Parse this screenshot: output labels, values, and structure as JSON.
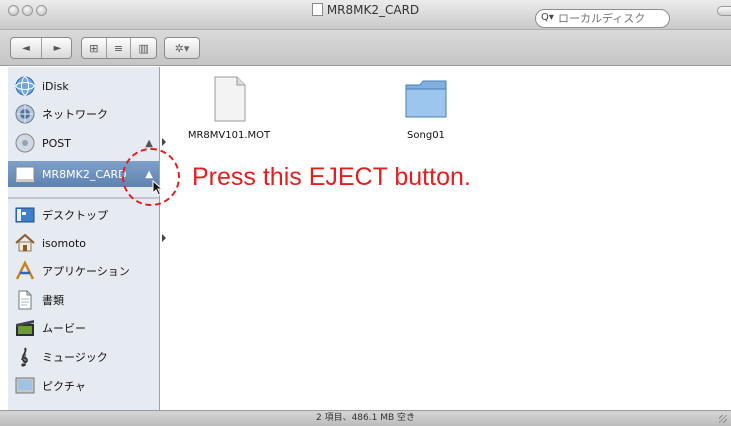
{
  "window": {
    "title": "MR8MK2_CARD"
  },
  "toolbar": {
    "back_icon": "◄",
    "forward_icon": "►",
    "view_icons": [
      "⊞",
      "≡",
      "▥"
    ],
    "action_label": "✲▾",
    "search_placeholder": "ローカルディスク",
    "search_icon": "Q▾"
  },
  "sidebar": {
    "items": [
      {
        "label": "iDisk",
        "icon": "idisk-icon"
      },
      {
        "label": "ネットワーク",
        "icon": "network-icon"
      },
      {
        "label": "POST",
        "icon": "disk-icon",
        "eject": "▲"
      },
      {
        "label": "MR8MK2_CARD",
        "icon": "card-drive-icon",
        "eject": "▲",
        "selected": true
      },
      {
        "label": "デスクトップ",
        "icon": "desktop-icon"
      },
      {
        "label": "isomoto",
        "icon": "home-icon"
      },
      {
        "label": "アプリケーション",
        "icon": "applications-icon"
      },
      {
        "label": "書類",
        "icon": "documents-icon"
      },
      {
        "label": "ムービー",
        "icon": "movies-icon"
      },
      {
        "label": "ミュージック",
        "icon": "music-icon"
      },
      {
        "label": "ピクチャ",
        "icon": "pictures-icon"
      }
    ]
  },
  "files": [
    {
      "name": "MR8MV101.MOT",
      "icon": "document-icon"
    },
    {
      "name": "Song01",
      "icon": "folder-icon"
    }
  ],
  "status": {
    "text": "2 項目、486.1 MB 空き"
  },
  "annotation": {
    "text": "Press this EJECT button.",
    "color": "#e02020"
  }
}
